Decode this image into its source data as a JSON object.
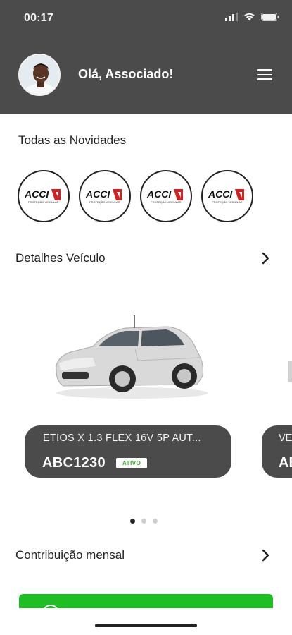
{
  "status_bar": {
    "time": "00:17"
  },
  "header": {
    "greeting": "Olá, Associado!"
  },
  "news": {
    "title": "Todas as Novidades",
    "items": [
      {
        "brand": "ACCI",
        "tagline": "PROTEÇÃO VEICULAR"
      },
      {
        "brand": "ACCI",
        "tagline": "PROTEÇÃO VEICULAR"
      },
      {
        "brand": "ACCI",
        "tagline": "PROTEÇÃO VEICULAR"
      },
      {
        "brand": "ACCI",
        "tagline": "PROTEÇÃO VEICULAR"
      }
    ]
  },
  "vehicles": {
    "title": "Detalhes Veículo",
    "cards": [
      {
        "model": "ETIOS X 1.3 FLEX 16V 5P AUT...",
        "plate": "ABC1230",
        "status": "ATIVO"
      },
      {
        "model": "VE",
        "plate": "AB"
      }
    ],
    "carousel": {
      "count": 3,
      "active_index": 0
    }
  },
  "contribution": {
    "title": "Contribuição mensal"
  },
  "colors": {
    "header_bg": "#4b4b4b",
    "accent_green": "#1fbe24",
    "badge_text": "#2bb31f"
  },
  "icons": [
    "wifi-icon",
    "battery-icon",
    "hamburger-menu-icon",
    "chevron-right-icon"
  ]
}
